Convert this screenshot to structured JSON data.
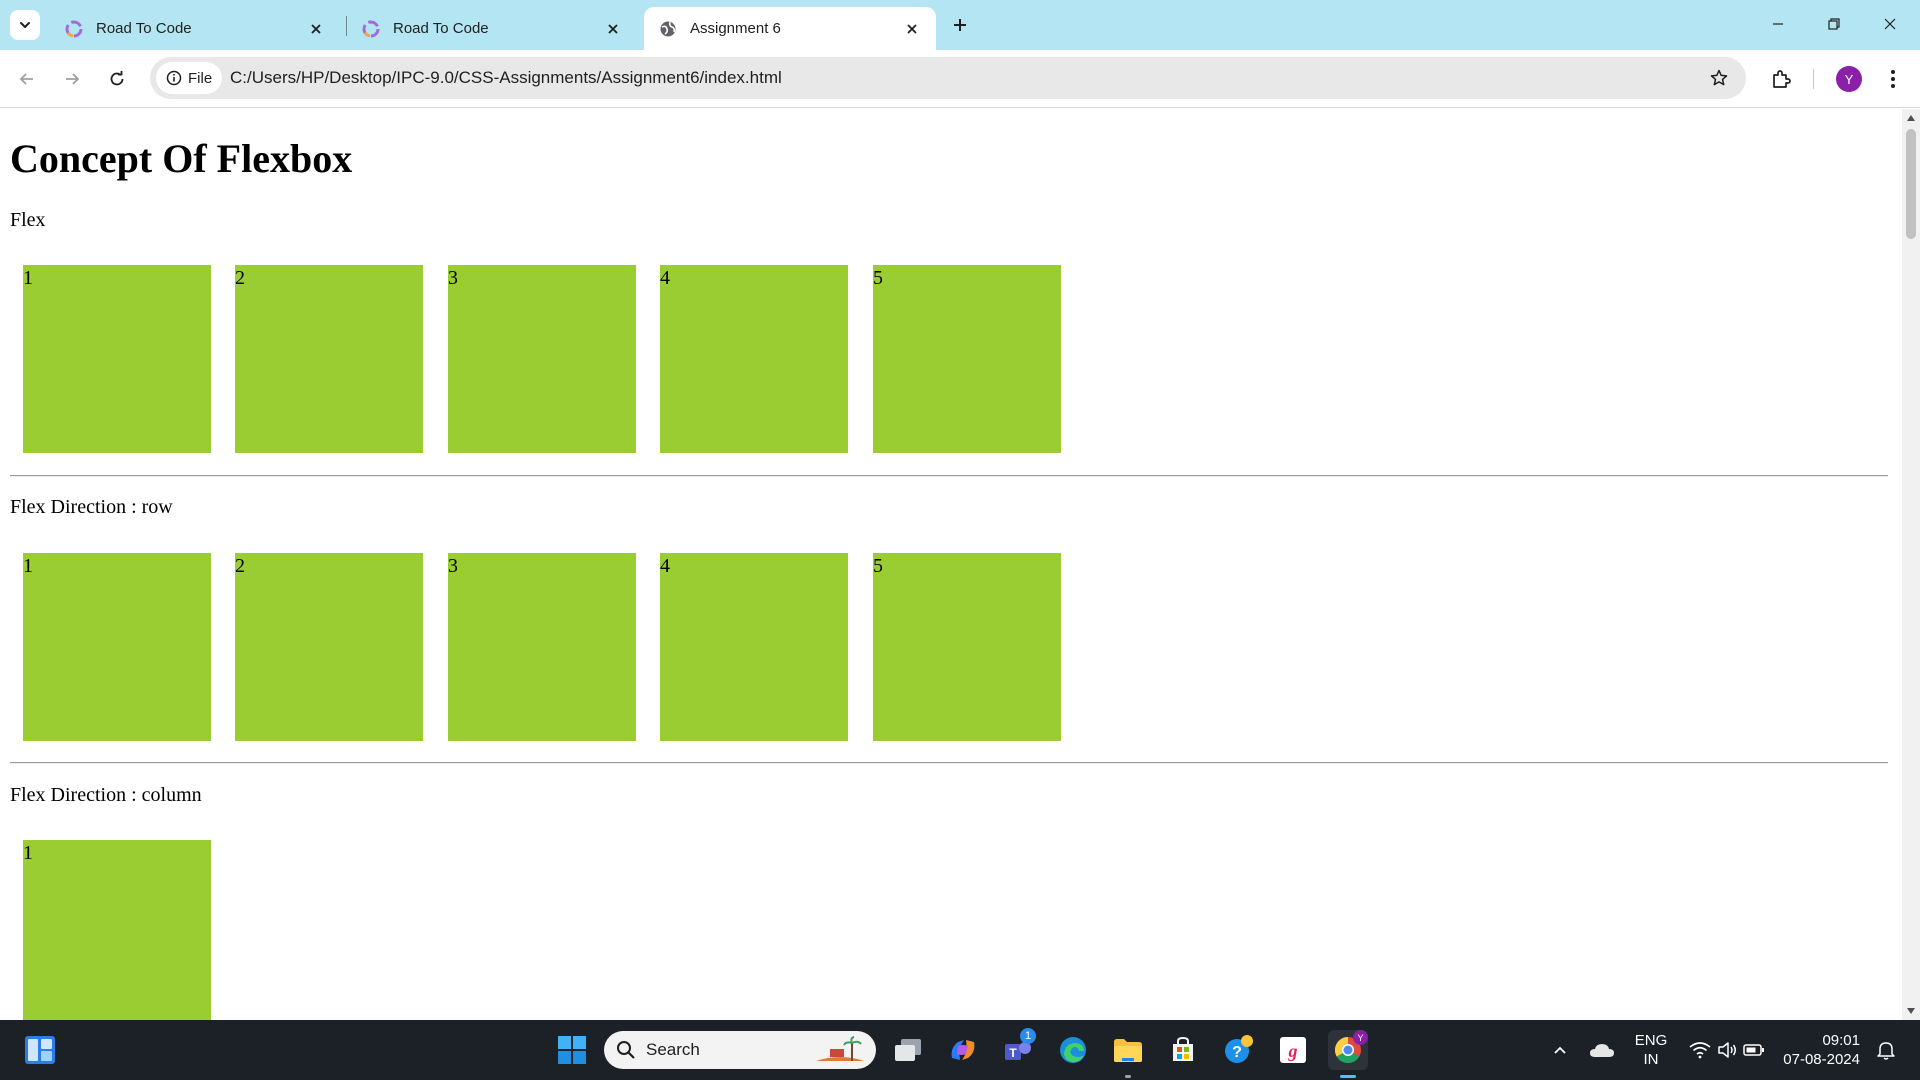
{
  "browser": {
    "tabs": [
      {
        "title": "Road To Code",
        "favicon": "road-to-code-logo",
        "active": false
      },
      {
        "title": "Road To Code",
        "favicon": "road-to-code-logo",
        "active": false
      },
      {
        "title": "Assignment 6",
        "favicon": "globe-icon",
        "active": true
      }
    ],
    "address_bar": {
      "scheme_chip": "File",
      "url": "C:/Users/HP/Desktop/IPC-9.0/CSS-Assignments/Assignment6/index.html"
    },
    "profile_initial": "Y"
  },
  "page": {
    "heading": "Concept Of Flexbox",
    "sections": [
      {
        "label": "Flex",
        "items": [
          "1",
          "2",
          "3",
          "4",
          "5"
        ]
      },
      {
        "label": "Flex Direction : row",
        "items": [
          "1",
          "2",
          "3",
          "4",
          "5"
        ]
      },
      {
        "label": "Flex Direction : column",
        "items": [
          "1"
        ]
      }
    ],
    "box_color": "#9acd32"
  },
  "taskbar": {
    "search_placeholder": "Search",
    "teams_badge": "1",
    "chrome_profile_badge": "Y",
    "language": "ENG",
    "region": "IN",
    "time": "09:01",
    "date": "07-08-2024"
  }
}
